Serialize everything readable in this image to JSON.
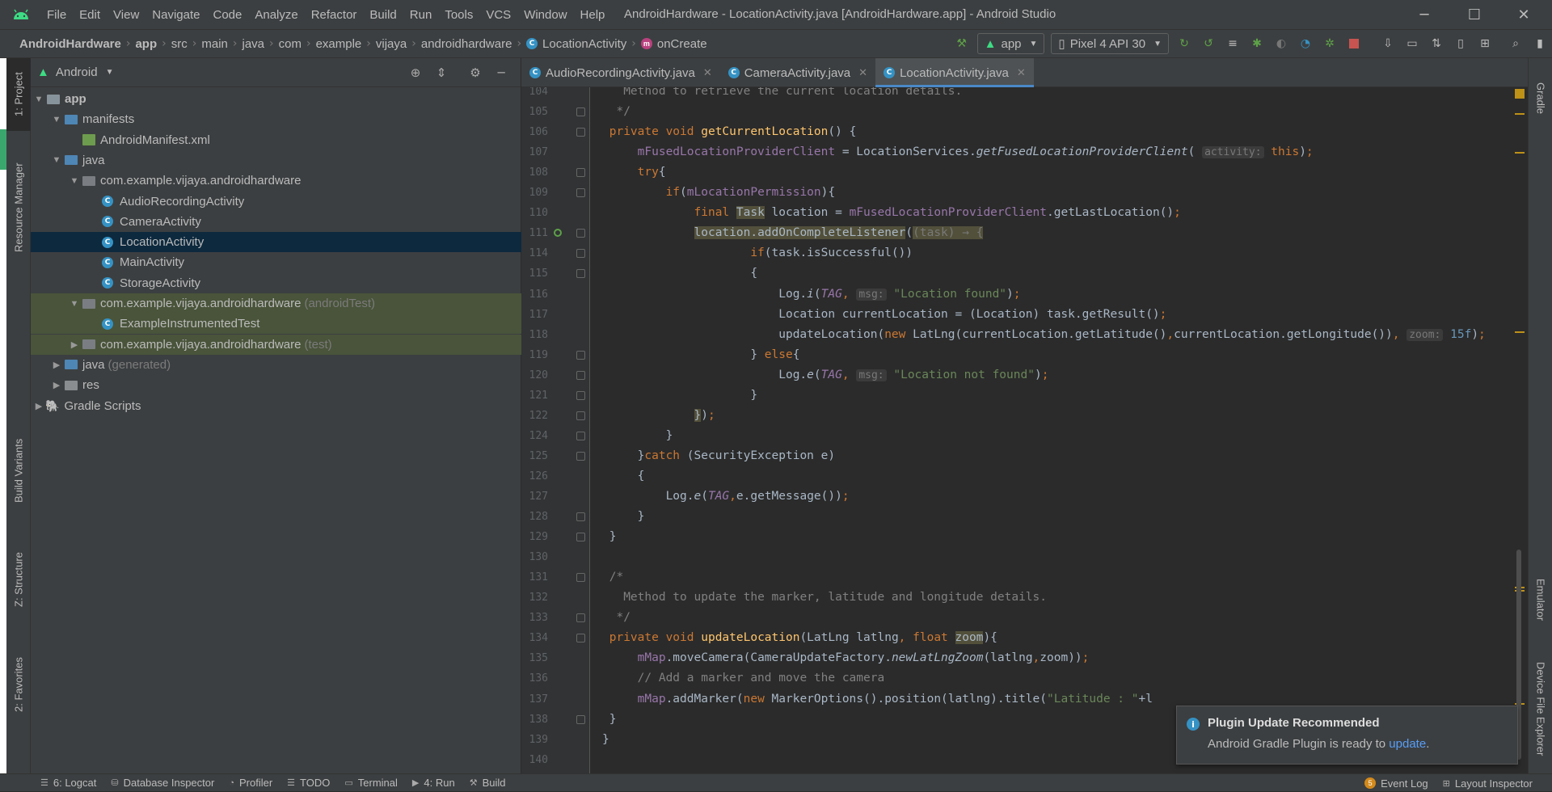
{
  "menu": [
    "File",
    "Edit",
    "View",
    "Navigate",
    "Code",
    "Analyze",
    "Refactor",
    "Build",
    "Run",
    "Tools",
    "VCS",
    "Window",
    "Help"
  ],
  "window_title": "AndroidHardware - LocationActivity.java [AndroidHardware.app] - Android Studio",
  "breadcrumb": {
    "project": "AndroidHardware",
    "module": "app",
    "parts": [
      "src",
      "main",
      "java",
      "com",
      "example",
      "vijaya",
      "androidhardware"
    ],
    "class": "LocationActivity",
    "method": "onCreate"
  },
  "toolbar": {
    "run_config": "app",
    "device": "Pixel 4 API 30"
  },
  "left_tools": [
    "1: Project",
    "Resource Manager",
    "Build Variants",
    "Z: Structure",
    "2: Favorites"
  ],
  "right_tools": [
    "Gradle",
    "Emulator",
    "Device File Explorer"
  ],
  "project_panel": {
    "view": "Android",
    "tree": [
      {
        "label": "app",
        "suffix": "",
        "type": "module",
        "expanded": true
      },
      {
        "label": "manifests",
        "suffix": "",
        "type": "folder",
        "expanded": true
      },
      {
        "label": "AndroidManifest.xml",
        "suffix": "",
        "type": "xml"
      },
      {
        "label": "java",
        "suffix": "",
        "type": "folder",
        "expanded": true
      },
      {
        "label": "com.example.vijaya.androidhardware",
        "suffix": "",
        "type": "package",
        "expanded": true
      },
      {
        "label": "AudioRecordingActivity",
        "suffix": "",
        "type": "class"
      },
      {
        "label": "CameraActivity",
        "suffix": "",
        "type": "class"
      },
      {
        "label": "LocationActivity",
        "suffix": "",
        "type": "class",
        "selected": true
      },
      {
        "label": "MainActivity",
        "suffix": "",
        "type": "class"
      },
      {
        "label": "StorageActivity",
        "suffix": "",
        "type": "class"
      },
      {
        "label": "com.example.vijaya.androidhardware",
        "suffix": "(androidTest)",
        "type": "package",
        "expanded": true
      },
      {
        "label": "ExampleInstrumentedTest",
        "suffix": "",
        "type": "testclass"
      },
      {
        "label": "com.example.vijaya.androidhardware",
        "suffix": "(test)",
        "type": "package",
        "expanded": false
      },
      {
        "label": "java",
        "suffix": "(generated)",
        "type": "folder",
        "expanded": false
      },
      {
        "label": "res",
        "suffix": "",
        "type": "folder",
        "expanded": false
      },
      {
        "label": "Gradle Scripts",
        "suffix": "",
        "type": "gradle",
        "expanded": false
      }
    ]
  },
  "editor_tabs": [
    {
      "label": "AudioRecordingActivity.java",
      "active": false
    },
    {
      "label": "CameraActivity.java",
      "active": false
    },
    {
      "label": "LocationActivity.java",
      "active": true
    }
  ],
  "code_lines": [
    {
      "n": "104",
      "html": "   <span class=\"cmt\">Method to retrieve the current location details.</span>"
    },
    {
      "n": "105",
      "html": "  <span class=\"cmt\">*/</span>"
    },
    {
      "n": "106",
      "html": " <span class=\"kw\">private void </span><span class=\"fn\">getCurrentLocation</span>() {"
    },
    {
      "n": "107",
      "html": "     <span class=\"fld\">mFusedLocationProviderClient</span> = LocationServices.<span class=\"it\">getFusedLocationProviderClient</span>( <span class=\"hint\">activity:</span> <span class=\"kw\">this</span>)<span class=\"kw\">;</span>"
    },
    {
      "n": "108",
      "html": "     <span class=\"kw\">try</span>{"
    },
    {
      "n": "109",
      "html": "         <span class=\"kw\">if</span>(<span class=\"fld\">mLocationPermission</span>){"
    },
    {
      "n": "110",
      "html": "             <span class=\"kw\">final </span><span class=\"hl2\">Task</span> location = <span class=\"fld\">mFusedLocationProviderClient</span>.getLastLocation()<span class=\"kw\">;</span>"
    },
    {
      "n": "111",
      "html": "             <span class=\"hl2\">location.addOnCompleteListener</span>(<span class=\"hl2\" style=\"color:#787878\">(task) → {</span>"
    },
    {
      "n": "114",
      "html": "                     <span class=\"kw\">if</span>(task.isSuccessful())"
    },
    {
      "n": "115",
      "html": "                     {"
    },
    {
      "n": "116",
      "html": "                         Log.<span class=\"it\">i</span>(<span class=\"fld it\">TAG</span><span class=\"kw\">, </span><span class=\"hint\">msg:</span> <span class=\"str\">\"Location found\"</span>)<span class=\"kw\">;</span>"
    },
    {
      "n": "117",
      "html": "                         Location currentLocation = (Location) task.getResult()<span class=\"kw\">;</span>"
    },
    {
      "n": "118",
      "html": "                         updateLocation(<span class=\"kw\">new </span>LatLng(currentLocation.getLatitude()<span class=\"kw\">,</span>currentLocation.getLongitude())<span class=\"kw\">, </span><span class=\"hint\">zoom:</span> <span class=\"num\">15f</span>)<span class=\"kw\">;</span>"
    },
    {
      "n": "119",
      "html": "                     } <span class=\"kw\">else</span>{"
    },
    {
      "n": "120",
      "html": "                         Log.<span class=\"it\">e</span>(<span class=\"fld it\">TAG</span><span class=\"kw\">, </span><span class=\"hint\">msg:</span> <span class=\"str\">\"Location not found\"</span>)<span class=\"kw\">;</span>"
    },
    {
      "n": "121",
      "html": "                     }"
    },
    {
      "n": "122",
      "html": "             <span class=\"hl2\">}</span>)<span class=\"kw\">;</span>"
    },
    {
      "n": "124",
      "html": "         }"
    },
    {
      "n": "125",
      "html": "     }<span class=\"kw\">catch </span>(SecurityException e)"
    },
    {
      "n": "126",
      "html": "     {"
    },
    {
      "n": "127",
      "html": "         Log.<span class=\"it\">e</span>(<span class=\"fld it\">TAG</span><span class=\"kw\">,</span>e.getMessage())<span class=\"kw\">;</span>"
    },
    {
      "n": "128",
      "html": "     }"
    },
    {
      "n": "129",
      "html": " }"
    },
    {
      "n": "130",
      "html": ""
    },
    {
      "n": "131",
      "html": " <span class=\"cmt\">/*</span>"
    },
    {
      "n": "132",
      "html": "   <span class=\"cmt\">Method to update the marker, latitude and longitude details.</span>"
    },
    {
      "n": "133",
      "html": "  <span class=\"cmt\">*/</span>"
    },
    {
      "n": "134",
      "html": " <span class=\"kw\">private void </span><span class=\"fn\">updateLocation</span>(LatLng latlng<span class=\"kw\">, float </span><span class=\"hl2\">zoom</span>){"
    },
    {
      "n": "135",
      "html": "     <span class=\"fld\">mMap</span>.moveCamera(CameraUpdateFactory.<span class=\"it\">newLatLngZoom</span>(latlng<span class=\"kw\">,</span>zoom))<span class=\"kw\">;</span>"
    },
    {
      "n": "136",
      "html": "     <span class=\"cmt\">// Add a marker and move the camera</span>"
    },
    {
      "n": "137",
      "html": "     <span class=\"fld\">mMap</span>.addMarker(<span class=\"kw\">new </span>MarkerOptions().position(latlng).title(<span class=\"str\">\"Latitude : \"</span>+l"
    },
    {
      "n": "138",
      "html": " }"
    },
    {
      "n": "139",
      "html": "}"
    },
    {
      "n": "140",
      "html": ""
    }
  ],
  "notification": {
    "title": "Plugin Update Recommended",
    "body": "Android Gradle Plugin is ready to ",
    "link": "update",
    "tail": "."
  },
  "statusbar": {
    "left": [
      "6: Logcat",
      "Database Inspector",
      "Profiler",
      "TODO",
      "Terminal",
      "4: Run",
      "Build"
    ],
    "event_count": "5",
    "event_log": "Event Log",
    "layout_inspector": "Layout Inspector"
  },
  "colors": {
    "accent": "#4a88c7",
    "android_green": "#3ddc84"
  }
}
